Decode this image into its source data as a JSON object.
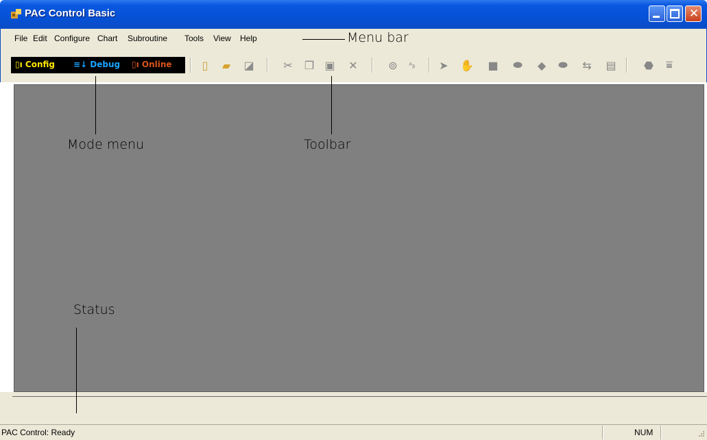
{
  "window": {
    "title": "PAC Control Basic"
  },
  "menubar": {
    "items": [
      {
        "label": "File"
      },
      {
        "label": "Edit"
      },
      {
        "label": "Configure"
      },
      {
        "label": "Chart"
      },
      {
        "label": "Subroutine"
      },
      {
        "label": "Tools"
      },
      {
        "label": "View"
      },
      {
        "label": "Help"
      }
    ]
  },
  "modes": [
    {
      "label": "Config",
      "color": "#ffe600"
    },
    {
      "label": "Debug",
      "color": "#19a3ff"
    },
    {
      "label": "Online",
      "color": "#d9541c"
    }
  ],
  "callouts": {
    "menu_bar": "Menu bar",
    "mode_menu": "Mode menu",
    "toolbar": "Toolbar",
    "status": "Status"
  },
  "statusbar": {
    "text": "PAC Control: Ready",
    "num": "NUM"
  },
  "colors": {
    "title_blue": "#0651d6",
    "canvas_gray": "#808080",
    "chrome": "#ece9d8"
  }
}
